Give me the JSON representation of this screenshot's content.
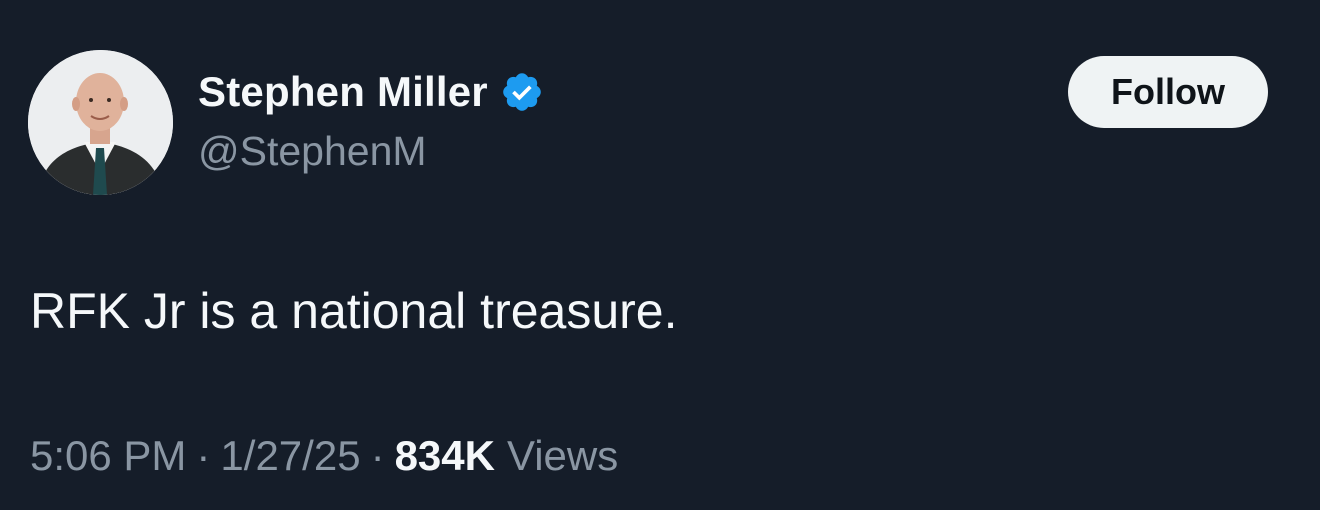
{
  "author": {
    "display_name": "Stephen Miller",
    "handle": "@StephenM",
    "verified_icon": "verified-badge-icon",
    "verified_color": "#1d9bf0",
    "avatar_icon": "profile-photo"
  },
  "follow_button": {
    "label": "Follow"
  },
  "tweet": {
    "text": "RFK Jr is a national treasure."
  },
  "meta": {
    "time": "5:06 PM",
    "separator": "·",
    "date": "1/27/25",
    "views_count": "834K",
    "views_label": "Views"
  },
  "colors": {
    "background": "#151d29",
    "primary_text": "#f5f8fa",
    "secondary_text": "#8a96a3",
    "button_bg": "#eff3f4"
  }
}
